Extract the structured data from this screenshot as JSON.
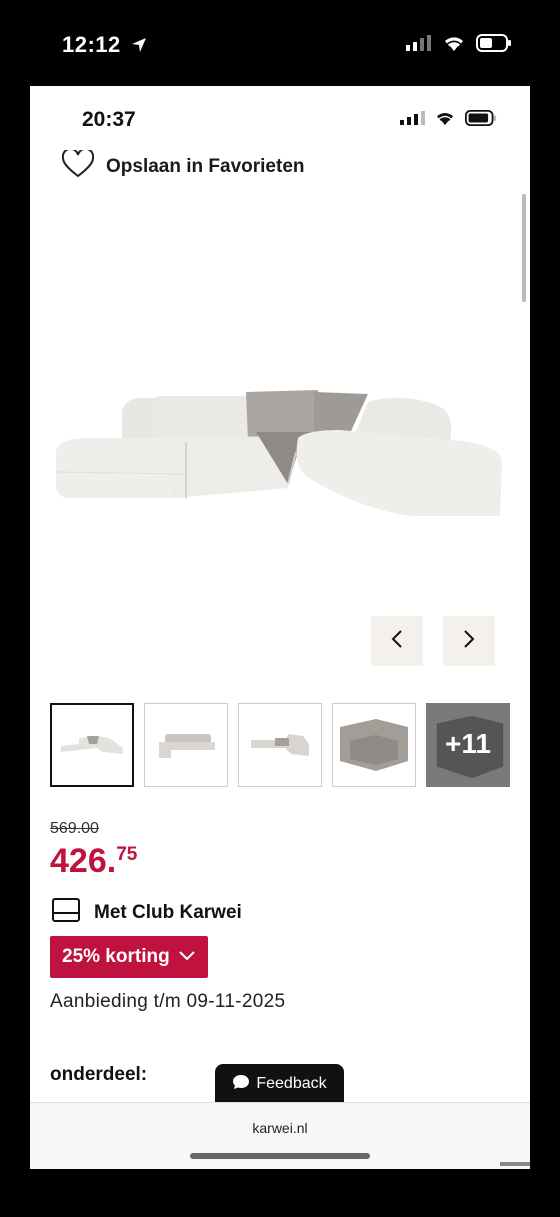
{
  "outer_status": {
    "time": "12:12"
  },
  "inner_status": {
    "time": "20:37"
  },
  "favorites": {
    "label": "Opslaan in Favorieten"
  },
  "gallery": {
    "more_label": "+11"
  },
  "price": {
    "old": "569.00",
    "main": "426.",
    "cents": "75"
  },
  "club": {
    "label": "Met Club Karwei"
  },
  "discount": {
    "label": "25% korting"
  },
  "offer": {
    "text": "Aanbieding t/m 09-11-2025"
  },
  "section": {
    "label": "onderdeel:"
  },
  "feedback": {
    "label": "Feedback"
  },
  "browser": {
    "url": "karwei.nl"
  },
  "colors": {
    "accent": "#c0123e",
    "sofa_light": "#e6e4e0",
    "sofa_dark": "#a8a39e"
  },
  "icons": [
    "location-arrow-icon",
    "signal-icon",
    "wifi-icon",
    "battery-icon",
    "heart-icon",
    "chevron-left-icon",
    "chevron-right-icon",
    "card-icon",
    "chevron-down-icon",
    "chat-bubble-icon"
  ]
}
